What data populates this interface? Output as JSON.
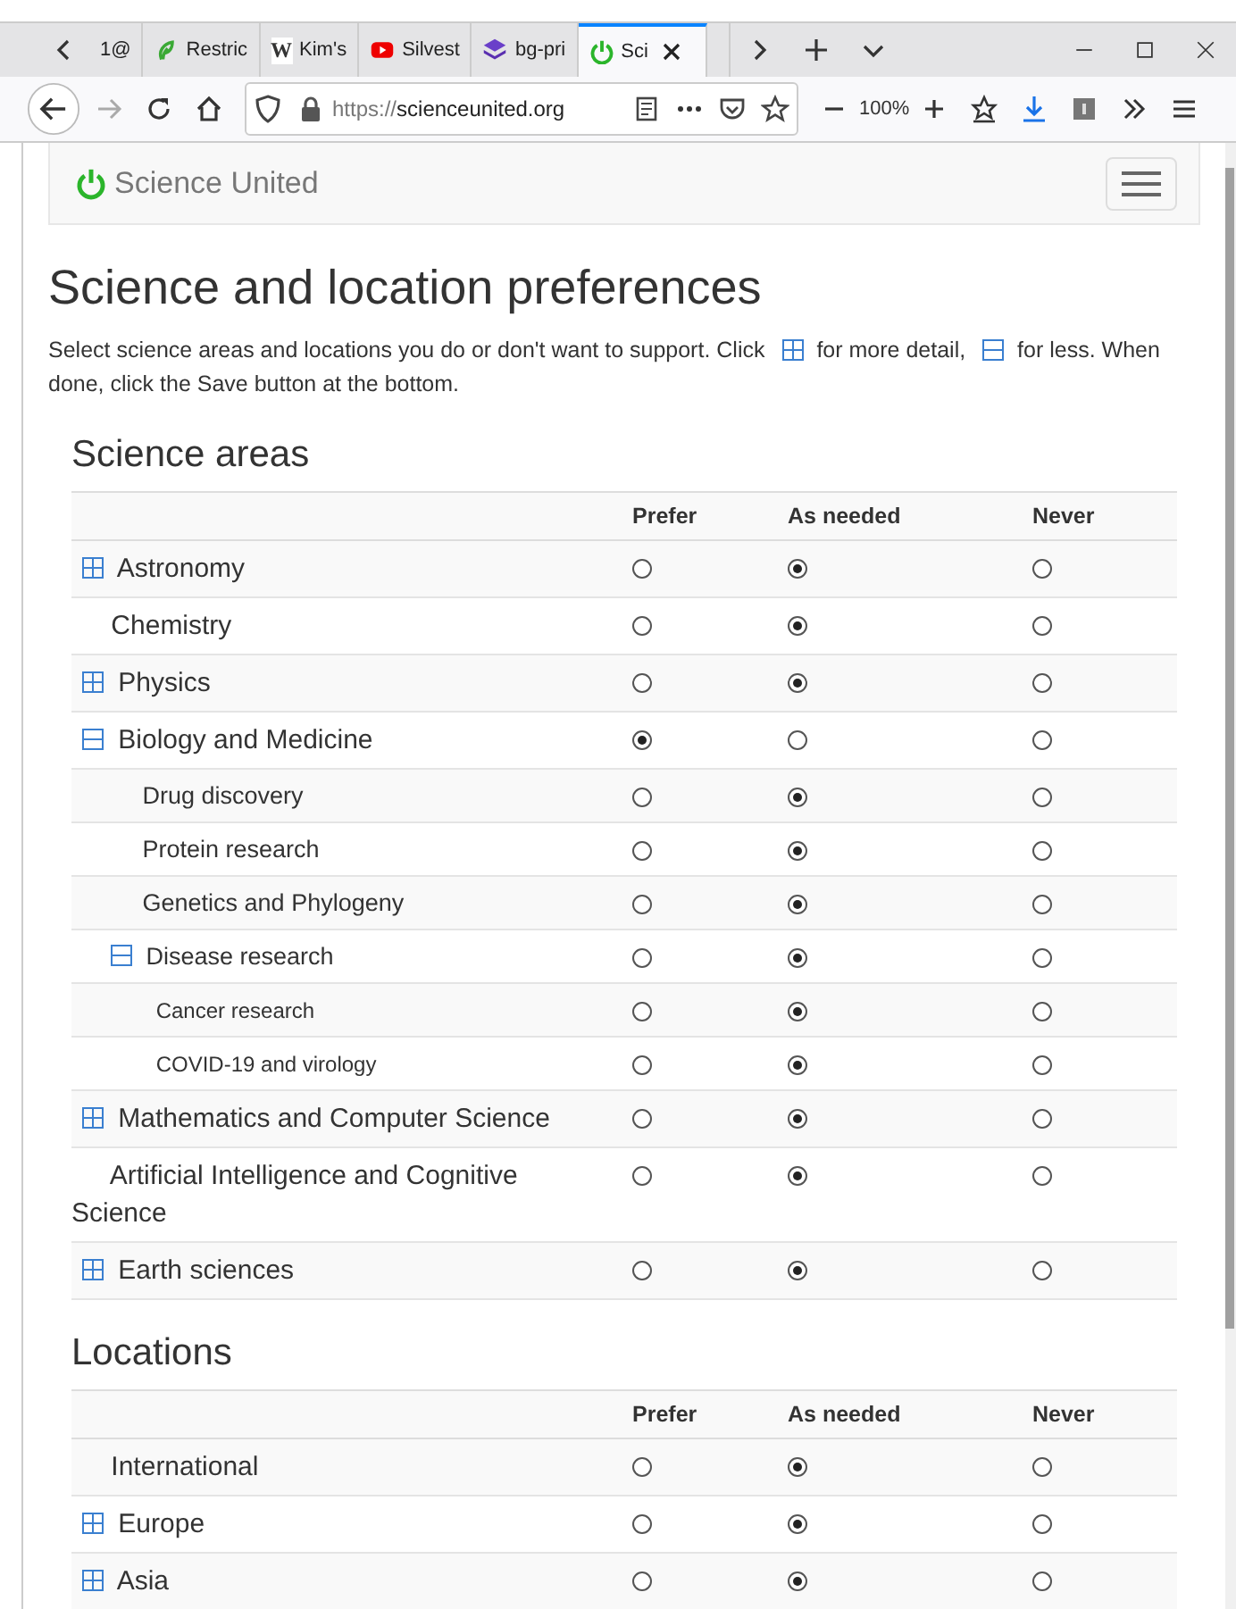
{
  "browser": {
    "tabs": [
      {
        "label": "1@",
        "selected": false
      },
      {
        "label": "Restric",
        "selected": false
      },
      {
        "label": "Kim's",
        "favicon_text": "W",
        "selected": false
      },
      {
        "label": "Silvest",
        "selected": false
      },
      {
        "label": "bg-pri",
        "selected": false
      },
      {
        "label": "Sci",
        "selected": true
      }
    ],
    "url": {
      "scheme": "https://",
      "host": "scienceunited.org"
    },
    "zoom": "100%"
  },
  "navbar": {
    "brand": "Science United"
  },
  "page": {
    "title": "Science and location preferences",
    "intro": [
      "Select science areas and locations you do or don't want to support. Click",
      "for more detail,",
      "for less. When",
      "done, click the Save button at the bottom."
    ]
  },
  "sections": [
    {
      "title": "Science areas",
      "columns": [
        "Prefer",
        "As needed",
        "Never"
      ],
      "rows": [
        {
          "label": "Astronomy",
          "expanded": false,
          "choices": [
            {
              "selected": false
            },
            {
              "selected": true
            },
            {
              "selected": false
            }
          ]
        },
        {
          "label": "Chemistry",
          "choices": [
            {
              "selected": false
            },
            {
              "selected": true
            },
            {
              "selected": false
            }
          ]
        },
        {
          "label": "Physics",
          "expanded": false,
          "choices": [
            {
              "selected": false
            },
            {
              "selected": true
            },
            {
              "selected": false
            }
          ]
        },
        {
          "label": "Biology and Medicine",
          "expanded": true,
          "choices": [
            {
              "selected": true
            },
            {
              "selected": false
            },
            {
              "selected": false
            }
          ],
          "children": [
            {
              "label": "Drug discovery",
              "choices": [
                {
                  "selected": false
                },
                {
                  "selected": true
                },
                {
                  "selected": false
                }
              ]
            },
            {
              "label": "Protein research",
              "choices": [
                {
                  "selected": false
                },
                {
                  "selected": true
                },
                {
                  "selected": false
                }
              ]
            },
            {
              "label": "Genetics and Phylogeny",
              "choices": [
                {
                  "selected": false
                },
                {
                  "selected": true
                },
                {
                  "selected": false
                }
              ]
            },
            {
              "label": "Disease research",
              "expanded": true,
              "choices": [
                {
                  "selected": false
                },
                {
                  "selected": true
                },
                {
                  "selected": false
                }
              ],
              "children": [
                {
                  "label": "Cancer research",
                  "choices": [
                    {
                      "selected": false
                    },
                    {
                      "selected": true
                    },
                    {
                      "selected": false
                    }
                  ]
                },
                {
                  "label": "COVID-19 and virology",
                  "choices": [
                    {
                      "selected": false
                    },
                    {
                      "selected": true
                    },
                    {
                      "selected": false
                    }
                  ]
                }
              ]
            }
          ]
        },
        {
          "label": "Mathematics and Computer Science",
          "expanded": false,
          "choices": [
            {
              "selected": false
            },
            {
              "selected": true
            },
            {
              "selected": false
            }
          ]
        },
        {
          "label": "Artificial Intelligence and Cognitive Science",
          "choices": [
            {
              "selected": false
            },
            {
              "selected": true
            },
            {
              "selected": false
            }
          ]
        },
        {
          "label": "Earth sciences",
          "expanded": false,
          "choices": [
            {
              "selected": false
            },
            {
              "selected": true
            },
            {
              "selected": false
            }
          ]
        }
      ]
    },
    {
      "title": "Locations",
      "columns": [
        "Prefer",
        "As needed",
        "Never"
      ],
      "rows": [
        {
          "label": "International",
          "choices": [
            {
              "selected": false
            },
            {
              "selected": true
            },
            {
              "selected": false
            }
          ]
        },
        {
          "label": "Europe",
          "expanded": false,
          "choices": [
            {
              "selected": false
            },
            {
              "selected": true
            },
            {
              "selected": false
            }
          ]
        },
        {
          "label": "Asia",
          "expanded": false,
          "choices": [
            {
              "selected": false
            },
            {
              "selected": true
            },
            {
              "selected": false
            }
          ]
        }
      ]
    }
  ]
}
